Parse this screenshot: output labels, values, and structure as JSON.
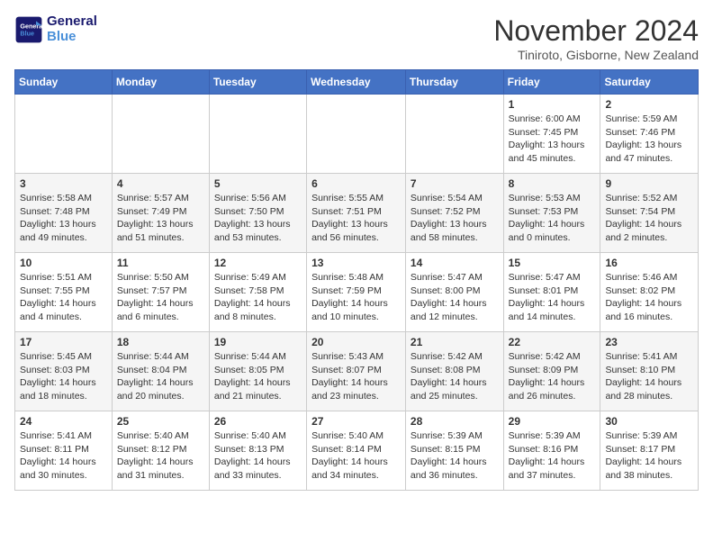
{
  "logo": {
    "line1": "General",
    "line2": "Blue"
  },
  "title": "November 2024",
  "location": "Tiniroto, Gisborne, New Zealand",
  "weekdays": [
    "Sunday",
    "Monday",
    "Tuesday",
    "Wednesday",
    "Thursday",
    "Friday",
    "Saturday"
  ],
  "weeks": [
    [
      {
        "day": "",
        "info": ""
      },
      {
        "day": "",
        "info": ""
      },
      {
        "day": "",
        "info": ""
      },
      {
        "day": "",
        "info": ""
      },
      {
        "day": "",
        "info": ""
      },
      {
        "day": "1",
        "info": "Sunrise: 6:00 AM\nSunset: 7:45 PM\nDaylight: 13 hours\nand 45 minutes."
      },
      {
        "day": "2",
        "info": "Sunrise: 5:59 AM\nSunset: 7:46 PM\nDaylight: 13 hours\nand 47 minutes."
      }
    ],
    [
      {
        "day": "3",
        "info": "Sunrise: 5:58 AM\nSunset: 7:48 PM\nDaylight: 13 hours\nand 49 minutes."
      },
      {
        "day": "4",
        "info": "Sunrise: 5:57 AM\nSunset: 7:49 PM\nDaylight: 13 hours\nand 51 minutes."
      },
      {
        "day": "5",
        "info": "Sunrise: 5:56 AM\nSunset: 7:50 PM\nDaylight: 13 hours\nand 53 minutes."
      },
      {
        "day": "6",
        "info": "Sunrise: 5:55 AM\nSunset: 7:51 PM\nDaylight: 13 hours\nand 56 minutes."
      },
      {
        "day": "7",
        "info": "Sunrise: 5:54 AM\nSunset: 7:52 PM\nDaylight: 13 hours\nand 58 minutes."
      },
      {
        "day": "8",
        "info": "Sunrise: 5:53 AM\nSunset: 7:53 PM\nDaylight: 14 hours\nand 0 minutes."
      },
      {
        "day": "9",
        "info": "Sunrise: 5:52 AM\nSunset: 7:54 PM\nDaylight: 14 hours\nand 2 minutes."
      }
    ],
    [
      {
        "day": "10",
        "info": "Sunrise: 5:51 AM\nSunset: 7:55 PM\nDaylight: 14 hours\nand 4 minutes."
      },
      {
        "day": "11",
        "info": "Sunrise: 5:50 AM\nSunset: 7:57 PM\nDaylight: 14 hours\nand 6 minutes."
      },
      {
        "day": "12",
        "info": "Sunrise: 5:49 AM\nSunset: 7:58 PM\nDaylight: 14 hours\nand 8 minutes."
      },
      {
        "day": "13",
        "info": "Sunrise: 5:48 AM\nSunset: 7:59 PM\nDaylight: 14 hours\nand 10 minutes."
      },
      {
        "day": "14",
        "info": "Sunrise: 5:47 AM\nSunset: 8:00 PM\nDaylight: 14 hours\nand 12 minutes."
      },
      {
        "day": "15",
        "info": "Sunrise: 5:47 AM\nSunset: 8:01 PM\nDaylight: 14 hours\nand 14 minutes."
      },
      {
        "day": "16",
        "info": "Sunrise: 5:46 AM\nSunset: 8:02 PM\nDaylight: 14 hours\nand 16 minutes."
      }
    ],
    [
      {
        "day": "17",
        "info": "Sunrise: 5:45 AM\nSunset: 8:03 PM\nDaylight: 14 hours\nand 18 minutes."
      },
      {
        "day": "18",
        "info": "Sunrise: 5:44 AM\nSunset: 8:04 PM\nDaylight: 14 hours\nand 20 minutes."
      },
      {
        "day": "19",
        "info": "Sunrise: 5:44 AM\nSunset: 8:05 PM\nDaylight: 14 hours\nand 21 minutes."
      },
      {
        "day": "20",
        "info": "Sunrise: 5:43 AM\nSunset: 8:07 PM\nDaylight: 14 hours\nand 23 minutes."
      },
      {
        "day": "21",
        "info": "Sunrise: 5:42 AM\nSunset: 8:08 PM\nDaylight: 14 hours\nand 25 minutes."
      },
      {
        "day": "22",
        "info": "Sunrise: 5:42 AM\nSunset: 8:09 PM\nDaylight: 14 hours\nand 26 minutes."
      },
      {
        "day": "23",
        "info": "Sunrise: 5:41 AM\nSunset: 8:10 PM\nDaylight: 14 hours\nand 28 minutes."
      }
    ],
    [
      {
        "day": "24",
        "info": "Sunrise: 5:41 AM\nSunset: 8:11 PM\nDaylight: 14 hours\nand 30 minutes."
      },
      {
        "day": "25",
        "info": "Sunrise: 5:40 AM\nSunset: 8:12 PM\nDaylight: 14 hours\nand 31 minutes."
      },
      {
        "day": "26",
        "info": "Sunrise: 5:40 AM\nSunset: 8:13 PM\nDaylight: 14 hours\nand 33 minutes."
      },
      {
        "day": "27",
        "info": "Sunrise: 5:40 AM\nSunset: 8:14 PM\nDaylight: 14 hours\nand 34 minutes."
      },
      {
        "day": "28",
        "info": "Sunrise: 5:39 AM\nSunset: 8:15 PM\nDaylight: 14 hours\nand 36 minutes."
      },
      {
        "day": "29",
        "info": "Sunrise: 5:39 AM\nSunset: 8:16 PM\nDaylight: 14 hours\nand 37 minutes."
      },
      {
        "day": "30",
        "info": "Sunrise: 5:39 AM\nSunset: 8:17 PM\nDaylight: 14 hours\nand 38 minutes."
      }
    ]
  ]
}
